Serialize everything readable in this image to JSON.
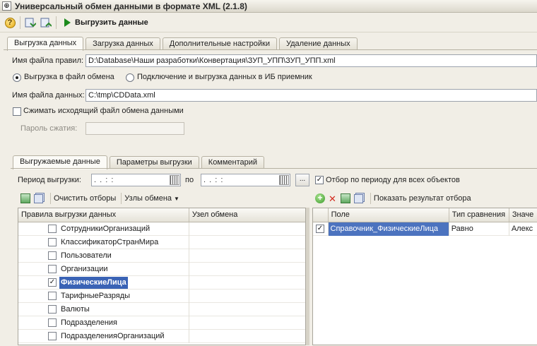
{
  "window": {
    "title": "Универсальный обмен данными в формате XML (2.1.8)",
    "sys_icon": "⊕"
  },
  "toolbar": {
    "help_icon": "?",
    "run_label": "Выгрузить данные"
  },
  "tabs_top": [
    "Выгрузка данных",
    "Загрузка данных",
    "Дополнительные настройки",
    "Удаление данных"
  ],
  "form": {
    "rules_file_label": "Имя файла правил:",
    "rules_file_value": "D:\\Database\\Наши разработки\\Конвертация\\ЗУП_УПП\\ЗУП_УПП.xml",
    "radio_file_label": "Выгрузка в файл обмена",
    "radio_ib_label": "Подключение и выгрузка данных в ИБ приемник",
    "data_file_label": "Имя файла данных:",
    "data_file_value": "C:\\tmp\\CDData.xml",
    "compress_label": "Сжимать исходящий файл обмена данными",
    "password_label": "Пароль сжатия:",
    "password_value": ""
  },
  "tabs_mid": [
    "Выгружаемые данные",
    "Параметры выгрузки",
    "Комментарий"
  ],
  "period": {
    "label": "Период выгрузки:",
    "from_value": ". .      : :",
    "to_label": "по",
    "to_value": ". .      : :",
    "dots_label": "...",
    "filter_all_label": "Отбор по периоду для всех объектов"
  },
  "left_toolbar": {
    "clear_filters": "Очистить отборы",
    "exchange_nodes": "Узлы обмена"
  },
  "rules_grid": {
    "headers": [
      "Правила выгрузки данных",
      "Узел обмена"
    ],
    "rows": [
      {
        "name": "СотрудникиОрганизаций",
        "checked": false
      },
      {
        "name": "КлассификаторСтранМира",
        "checked": false
      },
      {
        "name": "Пользователи",
        "checked": false
      },
      {
        "name": "Организации",
        "checked": false
      },
      {
        "name": "ФизическиеЛица",
        "checked": true,
        "selected": true
      },
      {
        "name": "ТарифныеРазряды",
        "checked": false
      },
      {
        "name": "Валюты",
        "checked": false
      },
      {
        "name": "Подразделения",
        "checked": false
      },
      {
        "name": "ПодразделенияОрганизаций",
        "checked": false
      }
    ]
  },
  "right_toolbar": {
    "show_result": "Показать результат отбора"
  },
  "filter_grid": {
    "headers": [
      "Поле",
      "Тип сравнения",
      "Значе"
    ],
    "rows": [
      {
        "field": "Справочник_ФизическиеЛица",
        "compare": "Равно",
        "value": "Алекс",
        "checked": true
      }
    ]
  },
  "colors": {
    "selection": "#3a63b5",
    "accent_green": "#1c8a1c"
  }
}
